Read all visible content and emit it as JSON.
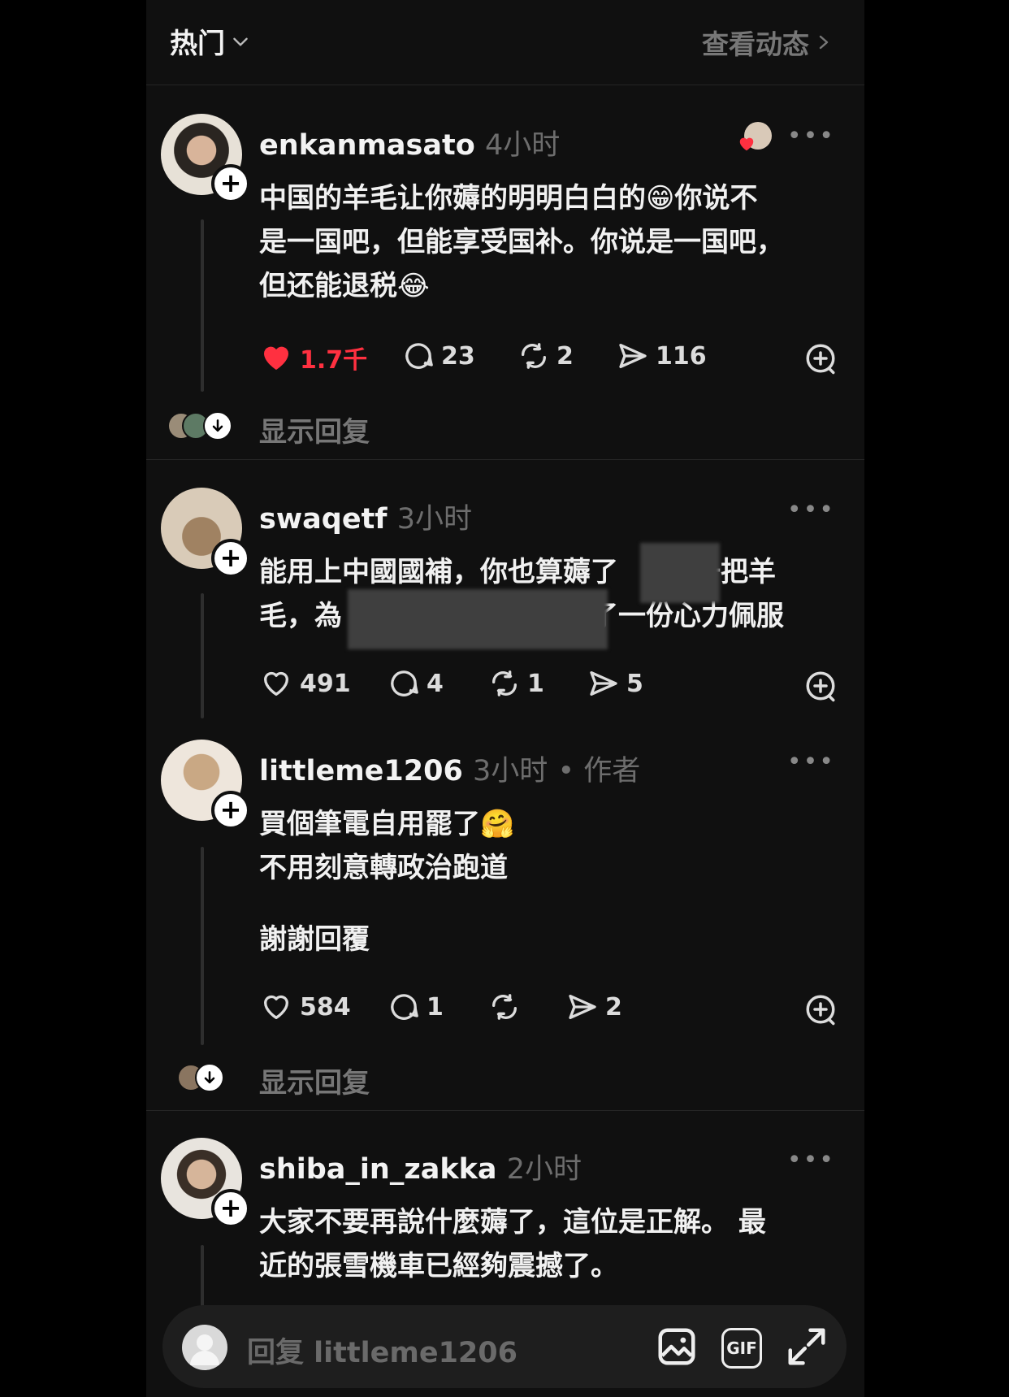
{
  "header": {
    "feed_label": "热门",
    "activity_link": "查看动态"
  },
  "posts": [
    {
      "username": "enkanmasato",
      "time": "4小时",
      "lines": [
        "中国的羊毛让你薅的明明白白的😁你说不",
        "是一国吧，但能享受国补。你说是一国吧，",
        "但还能退税😂"
      ],
      "likes": "1.7千",
      "comments": "23",
      "reposts": "2",
      "shares": "116",
      "show_replies": "显示回复"
    },
    {
      "username": "swaqetf",
      "time": "3小时",
      "line1a": "能用上中國國補，你也算薅了",
      "line1b": "一把羊",
      "line2a": "毛，為",
      "line2b": "了一份心力佩服",
      "likes": "491",
      "comments": "4",
      "reposts": "1",
      "shares": "5"
    },
    {
      "username": "littleme1206",
      "time": "3小时",
      "author_tag": "• 作者",
      "lines": [
        "買個筆電自用罷了🤗",
        "不用刻意轉政治跑道",
        "謝謝回覆"
      ],
      "likes": "584",
      "comments": "1",
      "shares": "2",
      "show_replies": "显示回复"
    },
    {
      "username": "shiba_in_zakka",
      "time": "2小时",
      "lines": [
        "大家不要再說什麼薅了，這位是正解。 最",
        "近的張雪機車已經夠震撼了。"
      ]
    }
  ],
  "reply_bar": {
    "placeholder": "回复 littleme1206",
    "gif_label": "GIF"
  },
  "colors": {
    "background": "#101010",
    "like_red": "#ff3040",
    "muted": "#777777"
  }
}
